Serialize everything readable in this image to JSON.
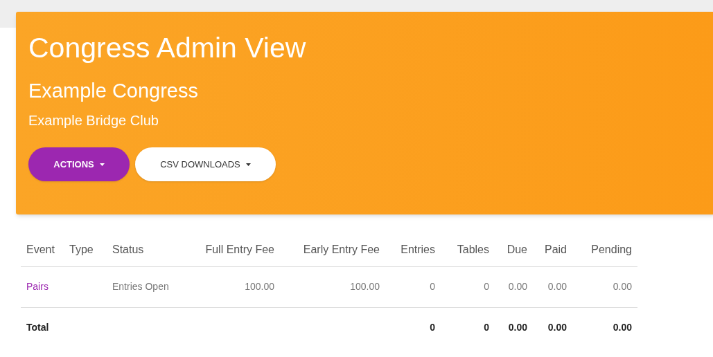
{
  "header": {
    "title": "Congress Admin View",
    "congress": "Example Congress",
    "club": "Example Bridge Club"
  },
  "buttons": [
    {
      "label": "ACTIONS",
      "kind": "primary"
    },
    {
      "label": "CSV DOWNLOADS",
      "kind": "light"
    }
  ],
  "table": {
    "columns": [
      "Event",
      "Type",
      "Status",
      "Full Entry Fee",
      "Early Entry Fee",
      "Entries",
      "Tables",
      "Due",
      "Paid",
      "Pending"
    ],
    "rows": [
      {
        "kind": "event",
        "cells": [
          "Pairs",
          "",
          "Entries Open",
          "100.00",
          "100.00",
          "0",
          "0",
          "0.00",
          "0.00",
          "0.00"
        ]
      },
      {
        "kind": "total",
        "cells": [
          "Total",
          "",
          "",
          "",
          "",
          "0",
          "0",
          "0.00",
          "0.00",
          "0.00"
        ]
      }
    ]
  }
}
